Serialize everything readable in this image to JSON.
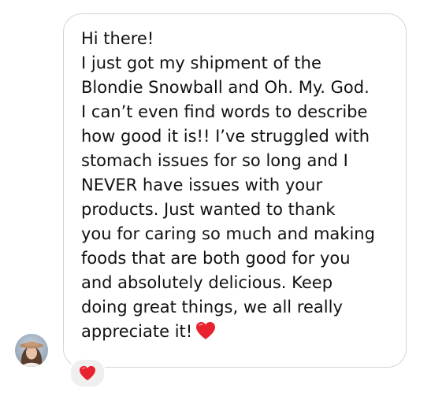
{
  "message": {
    "lines": [
      "Hi there!",
      "I just got my shipment of the",
      "Blondie Snowball and Oh. My. God.",
      "I can’t even find words to describe",
      "how good it is!! I’ve struggled with",
      "stomach issues for so long and I",
      "NEVER have issues with your",
      "products. Just wanted to thank",
      "you for caring so much and making",
      "foods that are both good for you",
      "and absolutely delicious. Keep",
      "doing great things, we all really",
      "appreciate it!"
    ],
    "inline_emoji": "red-heart-icon"
  },
  "reaction": {
    "emoji": "red-heart-icon"
  },
  "colors": {
    "heart": "#e8232f",
    "bubble_border": "#d4d4d4",
    "text": "#111111",
    "reaction_bg": "#efefef"
  }
}
